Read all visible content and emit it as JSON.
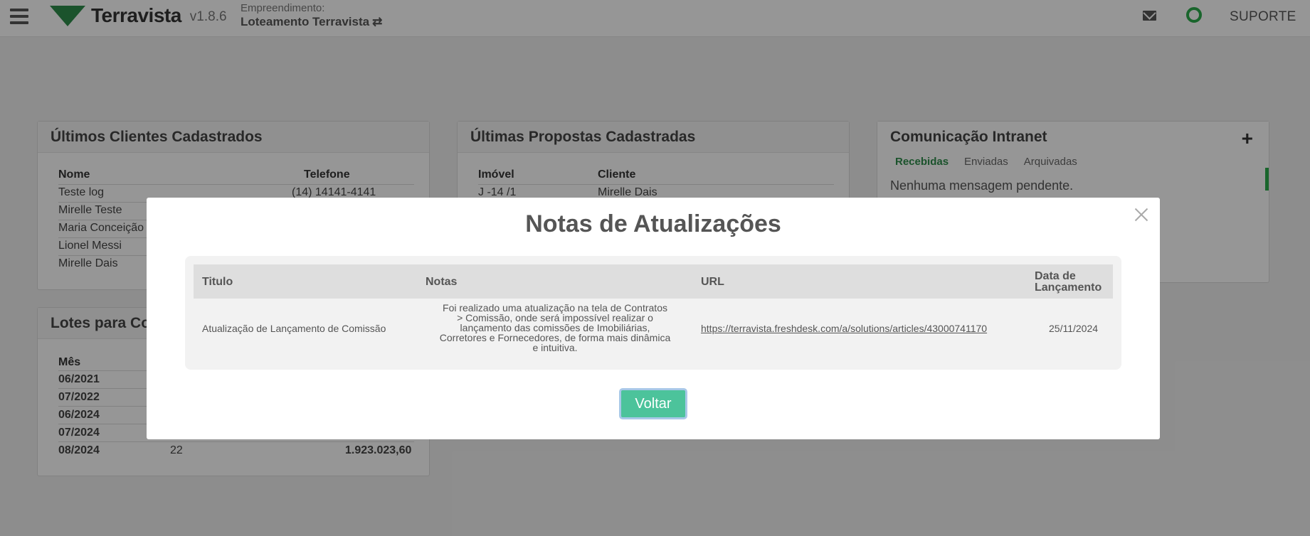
{
  "header": {
    "brand": "Terravista",
    "version": "v1.8.6",
    "project_label": "Empreendimento:",
    "project_name": "Loteamento Terravista",
    "swap_icon": "⇄",
    "support_label": "SUPORTE",
    "status_color": "#2aa84a"
  },
  "clients_card": {
    "title": "Últimos Clientes Cadastrados",
    "columns": [
      "Nome",
      "Telefone"
    ],
    "rows": [
      {
        "nome": "Teste log",
        "telefone": "(14) 14141-4141"
      },
      {
        "nome": "Mirelle Teste",
        "telefone": ""
      },
      {
        "nome": "Maria Conceição",
        "telefone": ""
      },
      {
        "nome": "Lionel Messi",
        "telefone": ""
      },
      {
        "nome": "Mirelle Dais",
        "telefone": ""
      }
    ]
  },
  "lots_card": {
    "title": "Lotes para Co",
    "columns": [
      "Mês"
    ],
    "rows": [
      {
        "mes": "06/2021",
        "qtd": "",
        "valor": ""
      },
      {
        "mes": "07/2022",
        "qtd": "",
        "valor": ""
      },
      {
        "mes": "06/2024",
        "qtd": "",
        "valor": ""
      },
      {
        "mes": "07/2024",
        "qtd": "",
        "valor": ""
      },
      {
        "mes": "08/2024",
        "qtd": "22",
        "valor": "1.923.023,60"
      }
    ]
  },
  "proposals_card": {
    "title": "Últimas Propostas Cadastradas",
    "columns": [
      "Imóvel",
      "Cliente"
    ],
    "rows": [
      {
        "imovel": "J -14 /1",
        "cliente": "Mirelle Dais"
      }
    ]
  },
  "intranet_card": {
    "title": "Comunicação Intranet",
    "add_symbol": "+",
    "tabs": [
      "Recebidas",
      "Enviadas",
      "Arquivadas"
    ],
    "active_tab": "Recebidas",
    "empty_message": "Nenhuma mensagem pendente."
  },
  "modal": {
    "title": "Notas de Atualizações",
    "columns": {
      "titulo": "Titulo",
      "notas": "Notas",
      "url": "URL",
      "data_line1": "Data de",
      "data_line2": "Lançamento"
    },
    "row": {
      "titulo": "Atualização de Lançamento de Comissão",
      "notas_lines": [
        "Foi realizado uma atualização na tela de Contratos",
        "> Comissão, onde será impossível realizar o",
        "lançamento das comissões de Imobiliárias,",
        "Corretores e Fornecedores, de forma mais dinâmica",
        "e intuitiva."
      ],
      "url": "https://terravista.freshdesk.com/a/solutions/articles/43000741170",
      "data": "25/11/2024"
    },
    "back_button": "Voltar"
  }
}
